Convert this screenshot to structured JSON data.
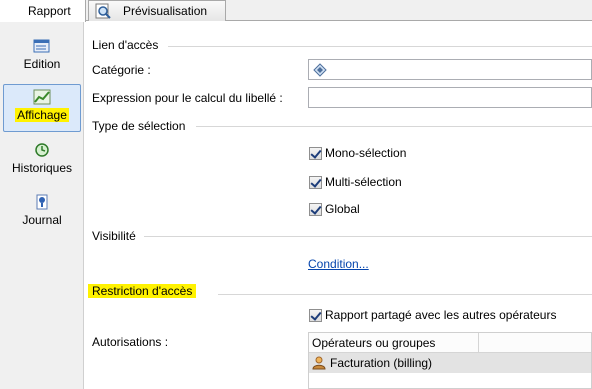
{
  "tabs": {
    "rapport": "Rapport",
    "previsualisation": "Prévisualisation"
  },
  "sidebar": {
    "edition": "Edition",
    "affichage": "Affichage",
    "historiques": "Historiques",
    "journal": "Journal"
  },
  "sections": {
    "lien_acces": "Lien d'accès",
    "type_selection": "Type de sélection",
    "visibilite": "Visibilité",
    "restriction_acces": "Restriction d'accès"
  },
  "fields": {
    "categorie_label": "Catégorie :",
    "expression_label": "Expression pour le calcul du libellé :",
    "autorisations_label": "Autorisations :"
  },
  "checkboxes": {
    "mono": "Mono-sélection",
    "multi": "Multi-sélection",
    "global": "Global",
    "partage": "Rapport partagé avec les autres opérateurs"
  },
  "links": {
    "condition": "Condition..."
  },
  "grid": {
    "header_col1": "Opérateurs ou groupes",
    "rows": [
      "Facturation (billing)"
    ]
  },
  "colors": {
    "highlight": "#fff200",
    "link": "#0645ad",
    "selected_item_bg": "#dbe9fa"
  }
}
